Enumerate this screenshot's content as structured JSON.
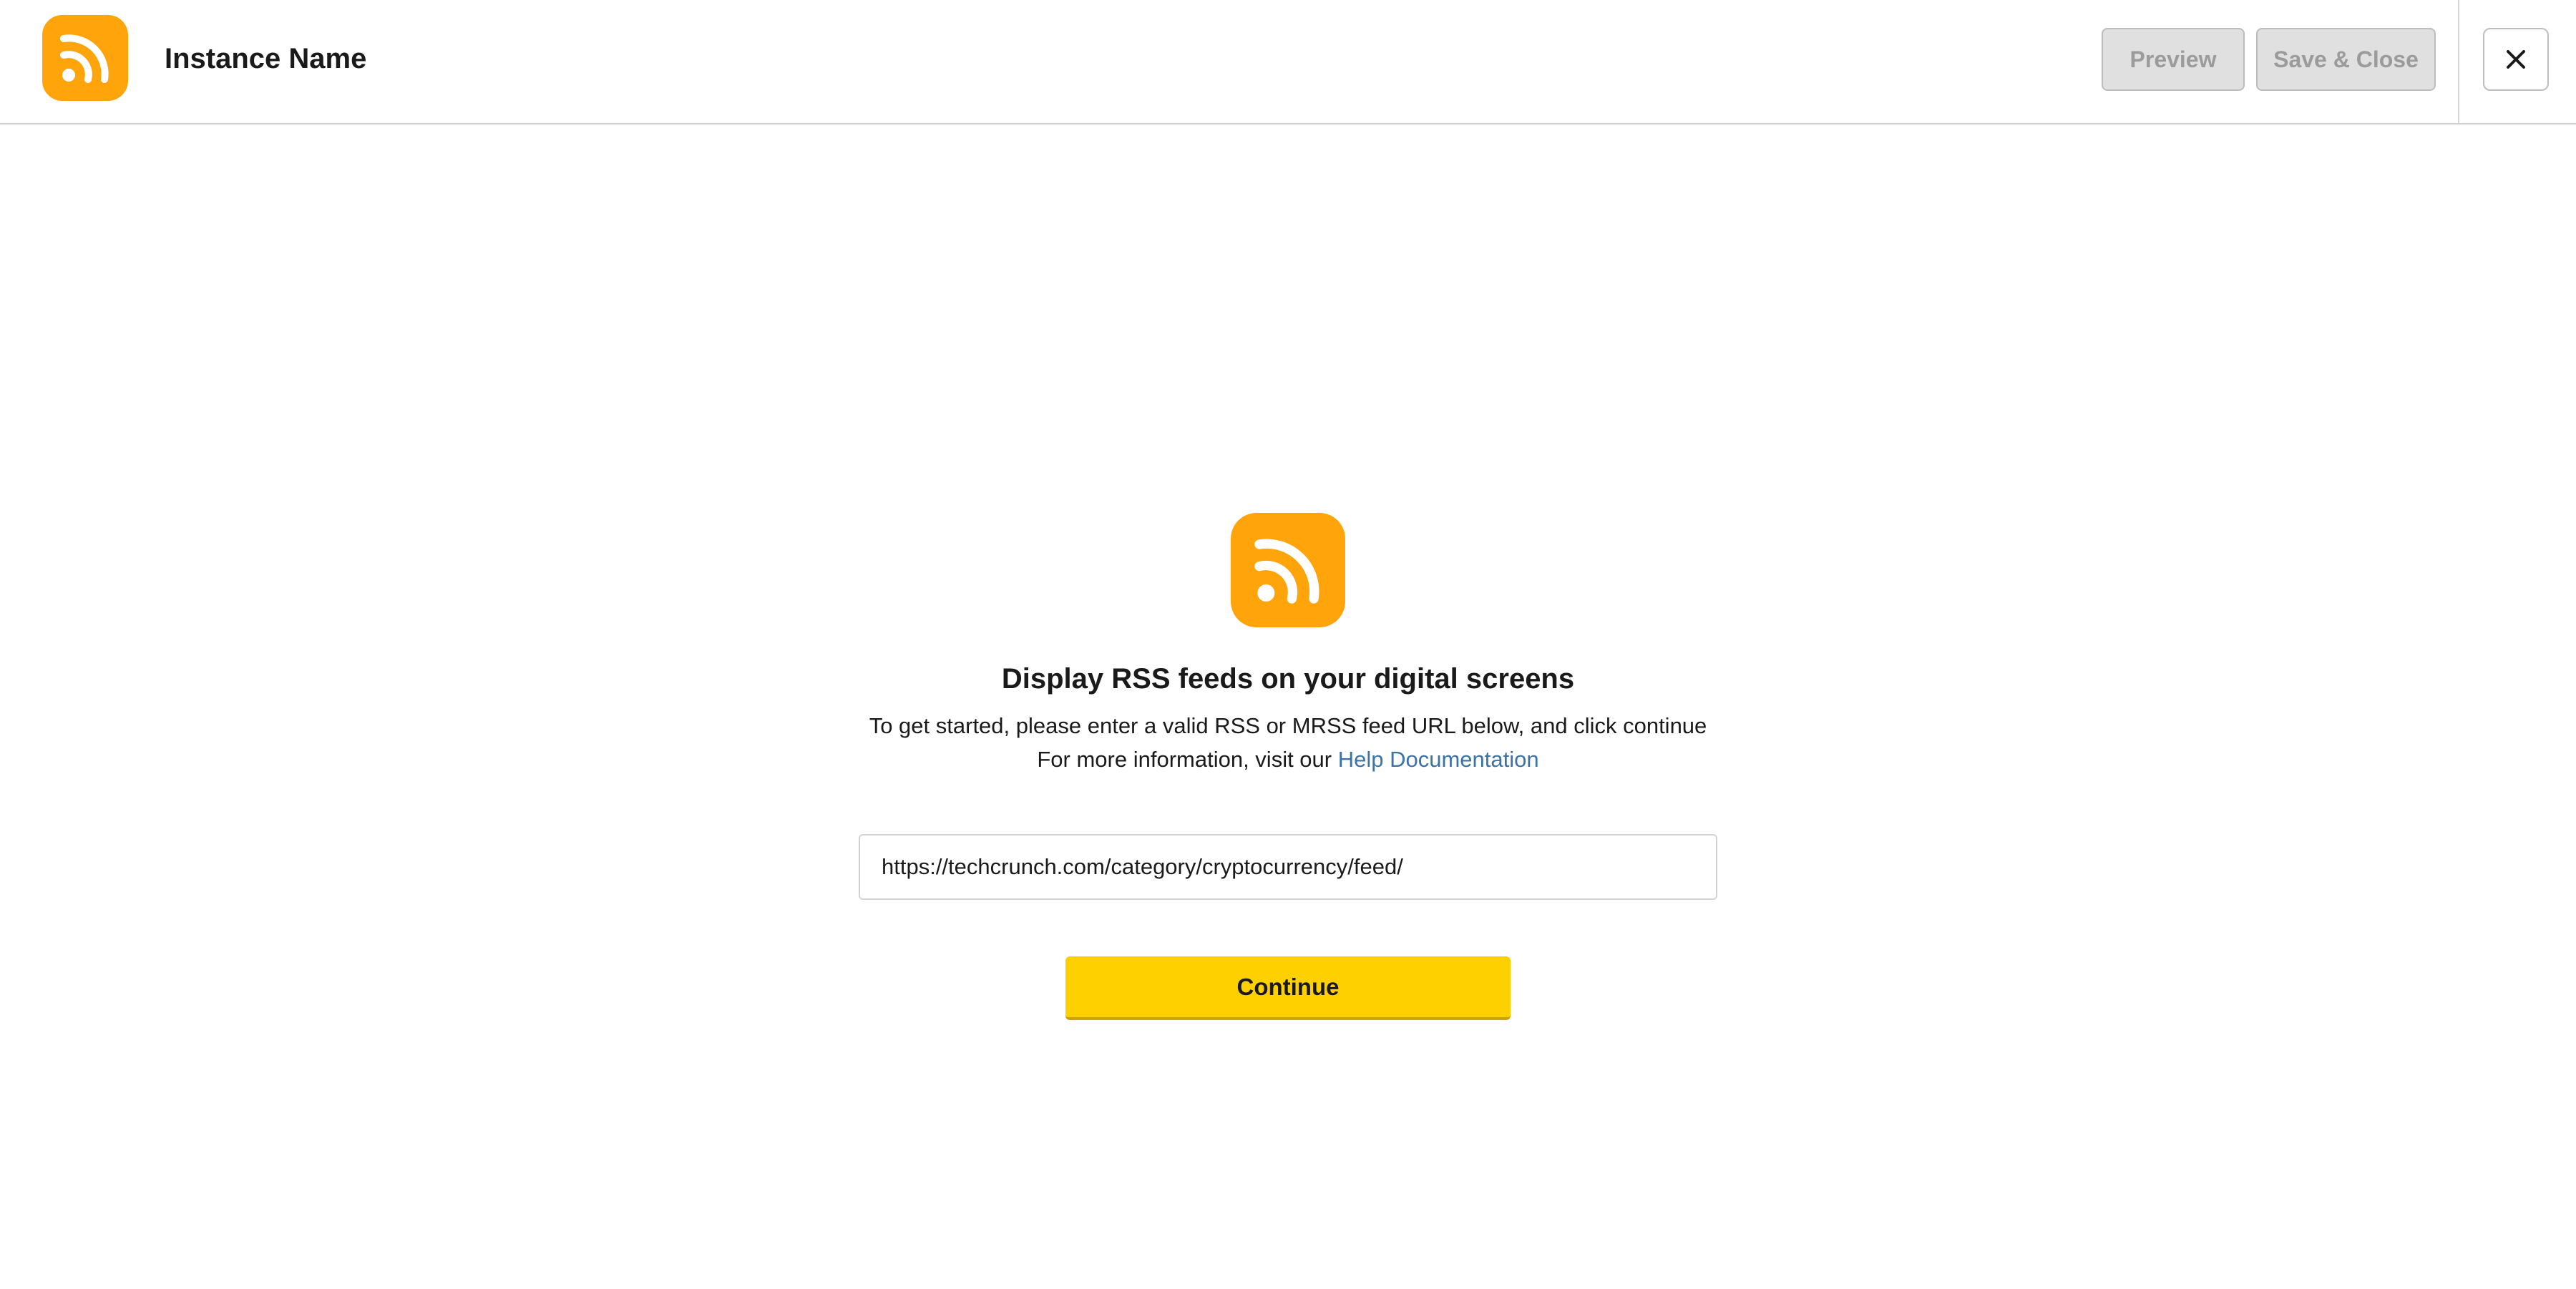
{
  "header": {
    "instance_name": "Instance Name",
    "preview_label": "Preview",
    "save_close_label": "Save & Close",
    "close_icon": "close-icon",
    "app_icon": "rss-icon"
  },
  "main": {
    "icon": "rss-icon",
    "title": "Display RSS feeds on your digital screens",
    "description_line1": "To get started, please enter a valid RSS or MRSS feed URL below, and click continue",
    "description_line2_prefix": "For more information, visit our",
    "help_link_label": "Help Documentation",
    "feed_url_value": "https://techcrunch.com/category/cryptocurrency/feed/",
    "continue_label": "Continue"
  },
  "colors": {
    "brand_orange": "#ffa40a",
    "accent_yellow": "#ffd000",
    "link_blue": "#3b73a8",
    "disabled_button_bg": "#e0e0e0"
  }
}
